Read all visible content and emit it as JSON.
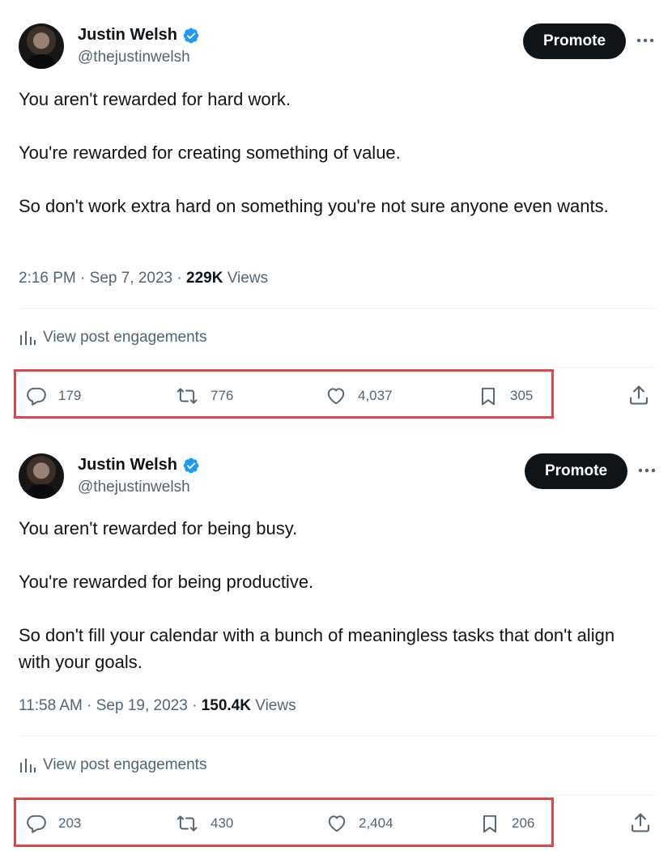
{
  "posts": [
    {
      "author": {
        "name": "Justin Welsh",
        "handle": "@thejustinwelsh",
        "verified_icon": "verified-badge-icon"
      },
      "promote_label": "Promote",
      "body": [
        "You aren't rewarded for hard work.",
        "You're rewarded for creating something of value.",
        "So don't work extra hard on something you're not sure anyone even wants."
      ],
      "timestamp": "2:16 PM · Sep 7, 2023 · ",
      "views_count": "229K",
      "views_label": " Views",
      "engagements_label": "View post engagements",
      "actions": {
        "replies": "179",
        "reposts": "776",
        "likes": "4,037",
        "bookmarks": "305"
      }
    },
    {
      "author": {
        "name": "Justin Welsh",
        "handle": "@thejustinwelsh",
        "verified_icon": "verified-badge-icon"
      },
      "promote_label": "Promote",
      "body": [
        "You aren't rewarded for being busy.",
        "You're rewarded for being productive.",
        "So don't fill your calendar with a bunch of meaningless tasks that don't align with your goals."
      ],
      "timestamp": "11:58 AM · Sep 19, 2023 · ",
      "views_count": "150.4K",
      "views_label": " Views",
      "engagements_label": "View post engagements",
      "actions": {
        "replies": "203",
        "reposts": "430",
        "likes": "2,404",
        "bookmarks": "206"
      }
    }
  ],
  "colors": {
    "primary_text": "#0f1419",
    "secondary_text": "#536471",
    "verified": "#1d9bf0",
    "highlight_box": "#e0474c"
  }
}
